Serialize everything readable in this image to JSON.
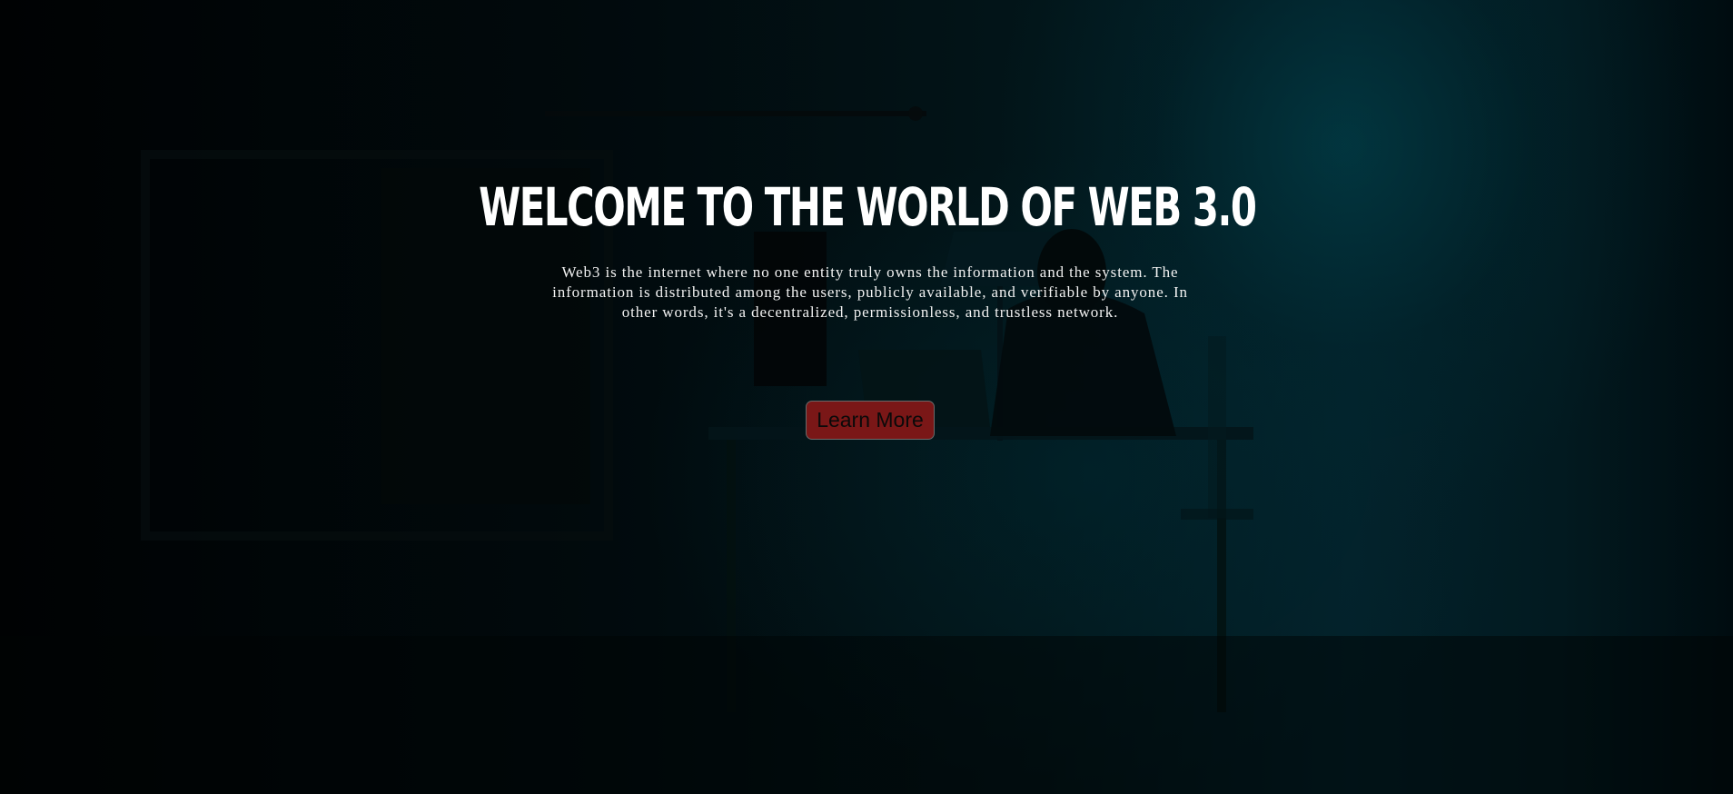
{
  "hero": {
    "title": "WELCOME TO THE WORLD OF WEB 3.0",
    "description": "Web3 is the internet where no one entity truly owns the information and the system. The information is distributed among the users, publicly available, and verifiable by anyone. In other words, it's a decentralized, permissionless, and trustless network.",
    "cta_label": "Learn More",
    "background_image": "hooded-figure-at-desk-dark-room",
    "colors": {
      "background_dark": "#000203",
      "background_teal": "#03212a",
      "title": "#ffffff",
      "description": "#f2f2f2",
      "cta_background": "#7a1717",
      "cta_text": "#0a0a0a"
    }
  }
}
